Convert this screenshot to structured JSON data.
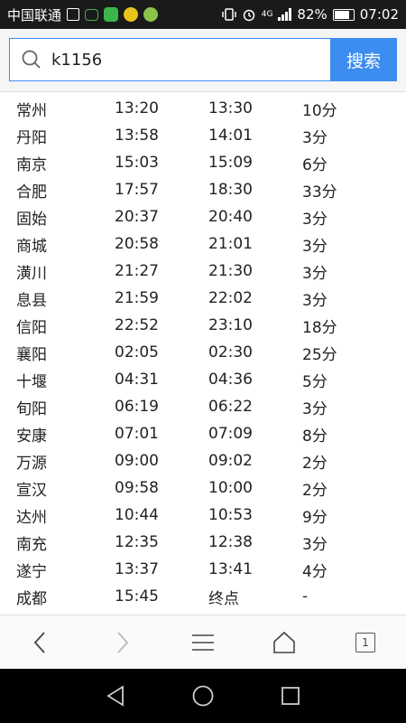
{
  "status_bar": {
    "carrier": "中国联通",
    "network": "4G",
    "battery": "82%",
    "time": "07:02"
  },
  "search": {
    "query": "k1156",
    "button_label": "搜索"
  },
  "schedule": {
    "rows": [
      {
        "station": "常州",
        "arrive": "13:20",
        "depart": "13:30",
        "stop": "10分"
      },
      {
        "station": "丹阳",
        "arrive": "13:58",
        "depart": "14:01",
        "stop": "3分"
      },
      {
        "station": "南京",
        "arrive": "15:03",
        "depart": "15:09",
        "stop": "6分"
      },
      {
        "station": "合肥",
        "arrive": "17:57",
        "depart": "18:30",
        "stop": "33分"
      },
      {
        "station": "固始",
        "arrive": "20:37",
        "depart": "20:40",
        "stop": "3分"
      },
      {
        "station": "商城",
        "arrive": "20:58",
        "depart": "21:01",
        "stop": "3分"
      },
      {
        "station": "潢川",
        "arrive": "21:27",
        "depart": "21:30",
        "stop": "3分"
      },
      {
        "station": "息县",
        "arrive": "21:59",
        "depart": "22:02",
        "stop": "3分"
      },
      {
        "station": "信阳",
        "arrive": "22:52",
        "depart": "23:10",
        "stop": "18分"
      },
      {
        "station": "襄阳",
        "arrive": "02:05",
        "depart": "02:30",
        "stop": "25分"
      },
      {
        "station": "十堰",
        "arrive": "04:31",
        "depart": "04:36",
        "stop": "5分"
      },
      {
        "station": "旬阳",
        "arrive": "06:19",
        "depart": "06:22",
        "stop": "3分"
      },
      {
        "station": "安康",
        "arrive": "07:01",
        "depart": "07:09",
        "stop": "8分"
      },
      {
        "station": "万源",
        "arrive": "09:00",
        "depart": "09:02",
        "stop": "2分"
      },
      {
        "station": "宣汉",
        "arrive": "09:58",
        "depart": "10:00",
        "stop": "2分"
      },
      {
        "station": "达州",
        "arrive": "10:44",
        "depart": "10:53",
        "stop": "9分"
      },
      {
        "station": "南充",
        "arrive": "12:35",
        "depart": "12:38",
        "stop": "3分"
      },
      {
        "station": "遂宁",
        "arrive": "13:37",
        "depart": "13:41",
        "stop": "4分"
      },
      {
        "station": "成都",
        "arrive": "15:45",
        "depart": "终点",
        "stop": "-"
      }
    ]
  },
  "toolbar": {
    "tab_count": "1",
    "icons": [
      "back-icon",
      "forward-icon",
      "menu-icon",
      "home-icon",
      "tabs-icon"
    ]
  },
  "colors": {
    "accent": "#3d8df0",
    "status_bar_bg": "#1a1a1a",
    "nav_bar_bg": "#000000"
  }
}
